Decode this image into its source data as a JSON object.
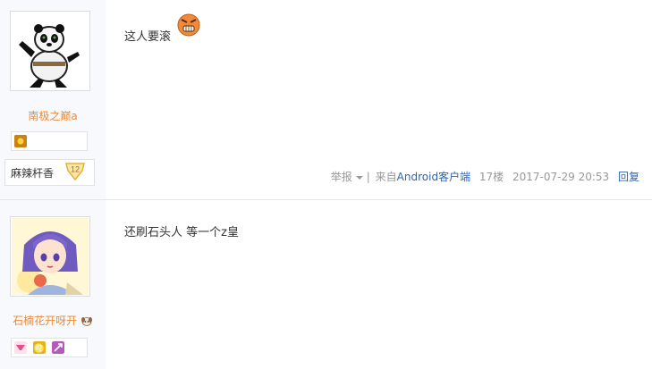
{
  "posts": [
    {
      "username": "南极之巅a",
      "bar_name": "麻辣杆香",
      "level": "12",
      "content": "这人要滚",
      "emoji_icon": "angry-face-icon",
      "tail": {
        "report": "举报",
        "divider": "|",
        "source_prefix": "来自",
        "source_link": "Android客户端",
        "floor": "17楼",
        "datetime": "2017-07-29 20:53",
        "reply": "回复"
      }
    },
    {
      "username": "石楠花开呀开",
      "content": "还刷石头人 等一个z皇"
    }
  ],
  "colors": {
    "username": "#ea8b39",
    "link": "#2d64b3",
    "muted": "#999999",
    "sidebar": "#f7f9fd"
  }
}
